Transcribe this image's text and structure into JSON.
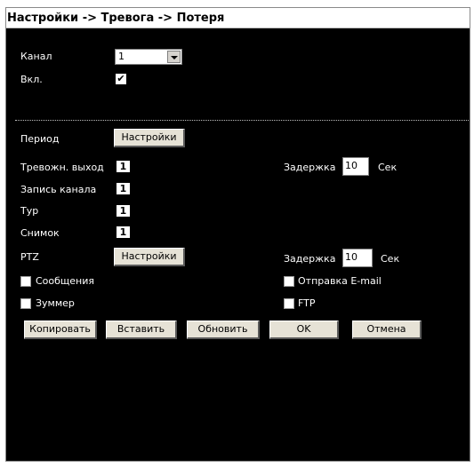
{
  "window": {
    "title": "Настройки -> Тревога -> Потеря"
  },
  "channel": {
    "label": "Канал",
    "value": "1"
  },
  "enable": {
    "label": "Вкл.",
    "checked": true
  },
  "period": {
    "label": "Период",
    "button": "Настройки"
  },
  "alarm_output": {
    "label": "Тревожн. выход",
    "value": "1",
    "delay_label": "Задержка",
    "delay_value": "10",
    "unit": "Сек"
  },
  "record_channel": {
    "label": "Запись канала",
    "value": "1"
  },
  "tour": {
    "label": "Тур",
    "value": "1"
  },
  "snapshot": {
    "label": "Снимок",
    "value": "1"
  },
  "ptz": {
    "label": "PTZ",
    "button": "Настройки",
    "delay_label": "Задержка",
    "delay_value": "10",
    "unit": "Сек"
  },
  "options": {
    "messages": "Сообщения",
    "email": "Отправка E-mail",
    "buzzer": "Зуммер",
    "ftp": "FTP"
  },
  "buttons": {
    "copy": "Копировать",
    "paste": "Вставить",
    "refresh": "Обновить",
    "ok": "OK",
    "cancel": "Отмена"
  }
}
